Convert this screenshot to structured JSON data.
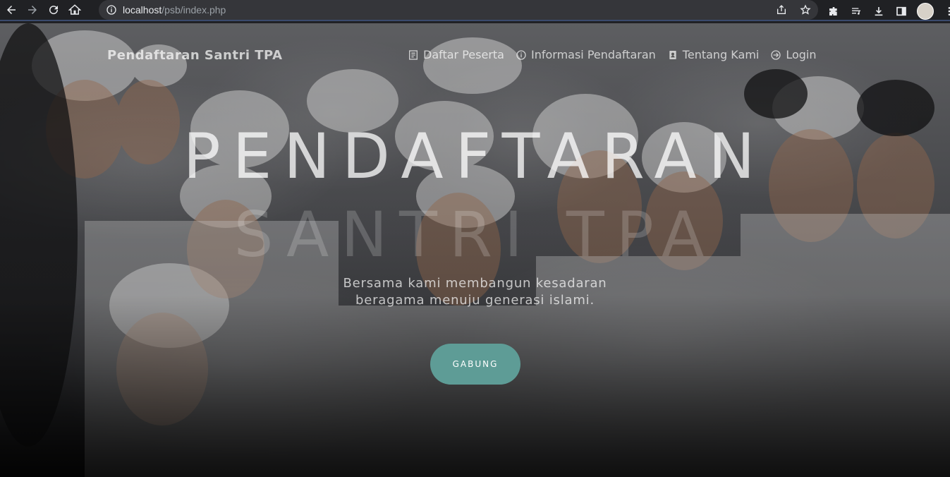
{
  "browser": {
    "url_host": "localhost",
    "url_path": "/psb/index.php"
  },
  "site": {
    "brand": "Pendaftaran Santri TPA",
    "menu": [
      {
        "label": "Daftar Peserta",
        "icon": "list-doc-icon"
      },
      {
        "label": "Informasi Pendaftaran",
        "icon": "info-icon"
      },
      {
        "label": "Tentang Kami",
        "icon": "contact-card-icon"
      },
      {
        "label": "Login",
        "icon": "login-icon"
      }
    ]
  },
  "hero": {
    "title_line1": "PENDAFTARAN",
    "title_line2": "SANTRI TPA",
    "subtitle_line1": "Bersama kami membangun kesadaran",
    "subtitle_line2": "beragama menuju generasi islami.",
    "cta_label": "GABUNG",
    "cta_color": "#5e9c96"
  }
}
